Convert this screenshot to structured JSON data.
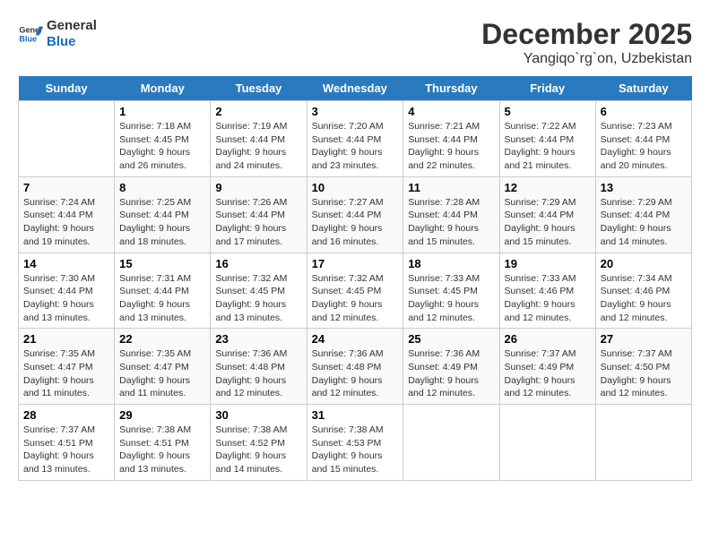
{
  "header": {
    "logo_line1": "General",
    "logo_line2": "Blue",
    "title": "December 2025",
    "subtitle": "Yangiqo`rg`on, Uzbekistan"
  },
  "days_of_week": [
    "Sunday",
    "Monday",
    "Tuesday",
    "Wednesday",
    "Thursday",
    "Friday",
    "Saturday"
  ],
  "weeks": [
    [
      {
        "date": "",
        "empty": true
      },
      {
        "date": "1",
        "sunrise": "7:18 AM",
        "sunset": "4:45 PM",
        "daylight": "9 hours and 26 minutes."
      },
      {
        "date": "2",
        "sunrise": "7:19 AM",
        "sunset": "4:44 PM",
        "daylight": "9 hours and 24 minutes."
      },
      {
        "date": "3",
        "sunrise": "7:20 AM",
        "sunset": "4:44 PM",
        "daylight": "9 hours and 23 minutes."
      },
      {
        "date": "4",
        "sunrise": "7:21 AM",
        "sunset": "4:44 PM",
        "daylight": "9 hours and 22 minutes."
      },
      {
        "date": "5",
        "sunrise": "7:22 AM",
        "sunset": "4:44 PM",
        "daylight": "9 hours and 21 minutes."
      },
      {
        "date": "6",
        "sunrise": "7:23 AM",
        "sunset": "4:44 PM",
        "daylight": "9 hours and 20 minutes."
      }
    ],
    [
      {
        "date": "7",
        "sunrise": "7:24 AM",
        "sunset": "4:44 PM",
        "daylight": "9 hours and 19 minutes."
      },
      {
        "date": "8",
        "sunrise": "7:25 AM",
        "sunset": "4:44 PM",
        "daylight": "9 hours and 18 minutes."
      },
      {
        "date": "9",
        "sunrise": "7:26 AM",
        "sunset": "4:44 PM",
        "daylight": "9 hours and 17 minutes."
      },
      {
        "date": "10",
        "sunrise": "7:27 AM",
        "sunset": "4:44 PM",
        "daylight": "9 hours and 16 minutes."
      },
      {
        "date": "11",
        "sunrise": "7:28 AM",
        "sunset": "4:44 PM",
        "daylight": "9 hours and 15 minutes."
      },
      {
        "date": "12",
        "sunrise": "7:29 AM",
        "sunset": "4:44 PM",
        "daylight": "9 hours and 15 minutes."
      },
      {
        "date": "13",
        "sunrise": "7:29 AM",
        "sunset": "4:44 PM",
        "daylight": "9 hours and 14 minutes."
      }
    ],
    [
      {
        "date": "14",
        "sunrise": "7:30 AM",
        "sunset": "4:44 PM",
        "daylight": "9 hours and 13 minutes."
      },
      {
        "date": "15",
        "sunrise": "7:31 AM",
        "sunset": "4:44 PM",
        "daylight": "9 hours and 13 minutes."
      },
      {
        "date": "16",
        "sunrise": "7:32 AM",
        "sunset": "4:45 PM",
        "daylight": "9 hours and 13 minutes."
      },
      {
        "date": "17",
        "sunrise": "7:32 AM",
        "sunset": "4:45 PM",
        "daylight": "9 hours and 12 minutes."
      },
      {
        "date": "18",
        "sunrise": "7:33 AM",
        "sunset": "4:45 PM",
        "daylight": "9 hours and 12 minutes."
      },
      {
        "date": "19",
        "sunrise": "7:33 AM",
        "sunset": "4:46 PM",
        "daylight": "9 hours and 12 minutes."
      },
      {
        "date": "20",
        "sunrise": "7:34 AM",
        "sunset": "4:46 PM",
        "daylight": "9 hours and 12 minutes."
      }
    ],
    [
      {
        "date": "21",
        "sunrise": "7:35 AM",
        "sunset": "4:47 PM",
        "daylight": "9 hours and 11 minutes."
      },
      {
        "date": "22",
        "sunrise": "7:35 AM",
        "sunset": "4:47 PM",
        "daylight": "9 hours and 11 minutes."
      },
      {
        "date": "23",
        "sunrise": "7:36 AM",
        "sunset": "4:48 PM",
        "daylight": "9 hours and 12 minutes."
      },
      {
        "date": "24",
        "sunrise": "7:36 AM",
        "sunset": "4:48 PM",
        "daylight": "9 hours and 12 minutes."
      },
      {
        "date": "25",
        "sunrise": "7:36 AM",
        "sunset": "4:49 PM",
        "daylight": "9 hours and 12 minutes."
      },
      {
        "date": "26",
        "sunrise": "7:37 AM",
        "sunset": "4:49 PM",
        "daylight": "9 hours and 12 minutes."
      },
      {
        "date": "27",
        "sunrise": "7:37 AM",
        "sunset": "4:50 PM",
        "daylight": "9 hours and 12 minutes."
      }
    ],
    [
      {
        "date": "28",
        "sunrise": "7:37 AM",
        "sunset": "4:51 PM",
        "daylight": "9 hours and 13 minutes."
      },
      {
        "date": "29",
        "sunrise": "7:38 AM",
        "sunset": "4:51 PM",
        "daylight": "9 hours and 13 minutes."
      },
      {
        "date": "30",
        "sunrise": "7:38 AM",
        "sunset": "4:52 PM",
        "daylight": "9 hours and 14 minutes."
      },
      {
        "date": "31",
        "sunrise": "7:38 AM",
        "sunset": "4:53 PM",
        "daylight": "9 hours and 15 minutes."
      },
      {
        "date": "",
        "empty": true
      },
      {
        "date": "",
        "empty": true
      },
      {
        "date": "",
        "empty": true
      }
    ]
  ],
  "labels": {
    "sunrise": "Sunrise:",
    "sunset": "Sunset:",
    "daylight": "Daylight:"
  }
}
